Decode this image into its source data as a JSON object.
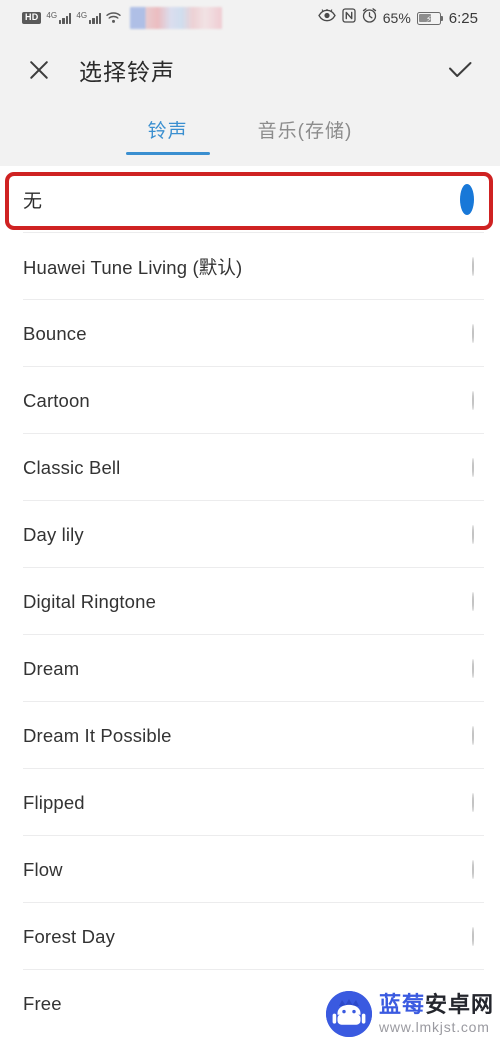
{
  "statusbar": {
    "hd_label": "HD",
    "network1": "4G",
    "network2": "4G",
    "wifi_icon": "wifi-icon",
    "carrier_redacted": "blurred-carrier-region",
    "eye_icon": "eye-icon",
    "nfc_icon": "nfc-icon",
    "alarm_icon": "alarm-icon",
    "battery_percent": "65%",
    "battery_icon": "battery-charging-icon",
    "time": "6:25"
  },
  "header": {
    "close_icon": "close-icon",
    "title": "选择铃声",
    "confirm_icon": "check-icon"
  },
  "tabs": [
    {
      "label": "铃声",
      "active": true
    },
    {
      "label": "音乐(存储)",
      "active": false
    }
  ],
  "colors": {
    "accent": "#3a8fd0",
    "radio_selected": "#1878d8",
    "annotation": "#cf2222",
    "header_bg": "#f2f2f2",
    "watermark_blue": "#3a5ae0"
  },
  "list": {
    "selected_value": "无",
    "items": [
      {
        "label": "无",
        "selected": true
      },
      {
        "label": "Huawei Tune Living (默认)",
        "selected": false
      },
      {
        "label": "Bounce",
        "selected": false
      },
      {
        "label": "Cartoon",
        "selected": false
      },
      {
        "label": "Classic Bell",
        "selected": false
      },
      {
        "label": "Day lily",
        "selected": false
      },
      {
        "label": "Digital Ringtone",
        "selected": false
      },
      {
        "label": "Dream",
        "selected": false
      },
      {
        "label": "Dream It Possible",
        "selected": false
      },
      {
        "label": "Flipped",
        "selected": false
      },
      {
        "label": "Flow",
        "selected": false
      },
      {
        "label": "Forest Day",
        "selected": false
      },
      {
        "label": "Free",
        "selected": false
      }
    ]
  },
  "annotation": {
    "target": "无",
    "shape": "red-rounded-rectangle"
  },
  "watermark": {
    "name_part1": "蓝莓",
    "name_part2": "安卓网",
    "url": "www.lmkjst.com",
    "logo_icon": "android-robot-icon"
  }
}
